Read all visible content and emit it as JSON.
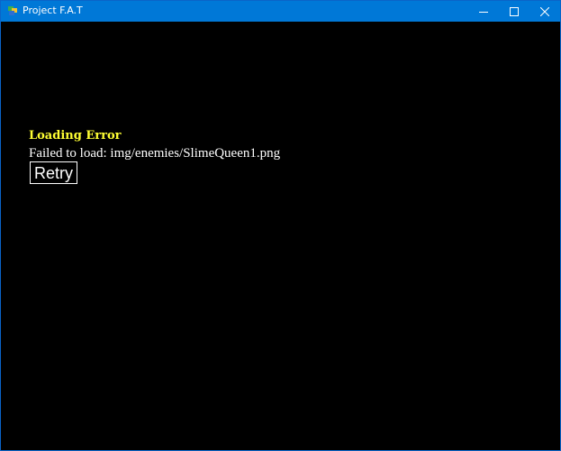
{
  "window": {
    "title": "Project F.A.T",
    "app_icon": "app-icon",
    "controls": {
      "minimize_icon": "minimize-icon",
      "maximize_icon": "maximize-icon",
      "close_icon": "close-icon"
    },
    "titlebar_color": "#0078d7"
  },
  "error": {
    "title": "Loading Error",
    "title_color": "#ffff33",
    "message": "Failed to load: img/enemies/SlimeQueen1.png",
    "message_color": "#ffffff",
    "retry_label": "Retry"
  },
  "background_color": "#000000"
}
